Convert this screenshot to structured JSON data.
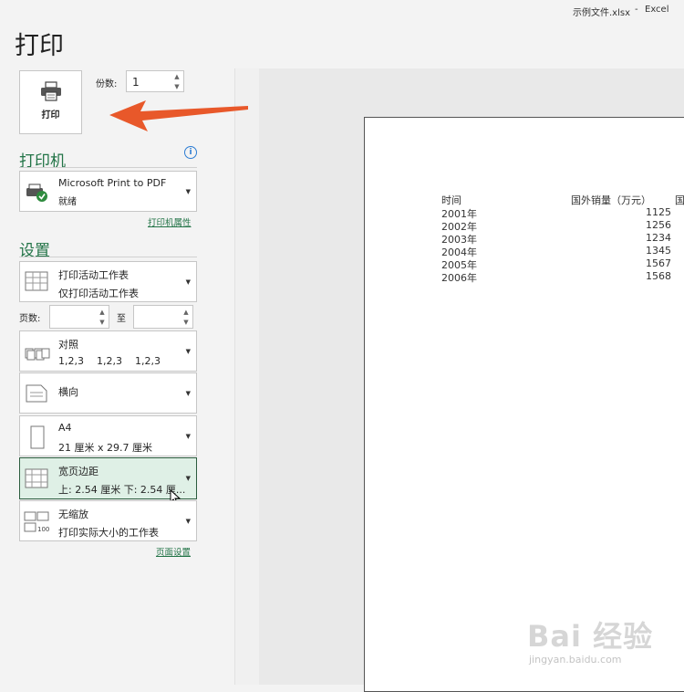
{
  "window": {
    "filename": "示例文件.xlsx",
    "separator": "-",
    "app": "Excel"
  },
  "page_title": "打印",
  "print_button": {
    "label": "打印"
  },
  "copies": {
    "label": "份数:",
    "value": "1"
  },
  "printer": {
    "section_title": "打印机",
    "name": "Microsoft Print to PDF",
    "status": "就绪",
    "properties_link": "打印机属性"
  },
  "settings": {
    "section_title": "设置",
    "what": {
      "line1": "打印活动工作表",
      "line2": "仅打印活动工作表"
    },
    "pages": {
      "label": "页数:",
      "to_label": "至"
    },
    "collate": {
      "line1": "对照",
      "line2": "1,2,3    1,2,3    1,2,3"
    },
    "orientation": {
      "line1": "横向"
    },
    "paper": {
      "line1": "A4",
      "line2": "21 厘米 x 29.7 厘米"
    },
    "margins": {
      "line1": "宽页边距",
      "line2": "上: 2.54 厘米 下: 2.54 厘..."
    },
    "scaling": {
      "line1": "无缩放",
      "line2": "打印实际大小的工作表"
    },
    "page_setup_link": "页面设置"
  },
  "preview": {
    "headers": [
      "时间",
      "国外销量（万元）",
      "国"
    ],
    "rows": [
      {
        "year": "2001年",
        "value": "1125"
      },
      {
        "year": "2002年",
        "value": "1256"
      },
      {
        "year": "2003年",
        "value": "1234"
      },
      {
        "year": "2004年",
        "value": "1345"
      },
      {
        "year": "2005年",
        "value": "1567"
      },
      {
        "year": "2006年",
        "value": "1568"
      }
    ]
  },
  "watermark": {
    "text": "Bai 经验",
    "url": "jingyan.baidu.com"
  },
  "colors": {
    "accent_green": "#217346",
    "annotation_arrow": "#e8582a"
  }
}
